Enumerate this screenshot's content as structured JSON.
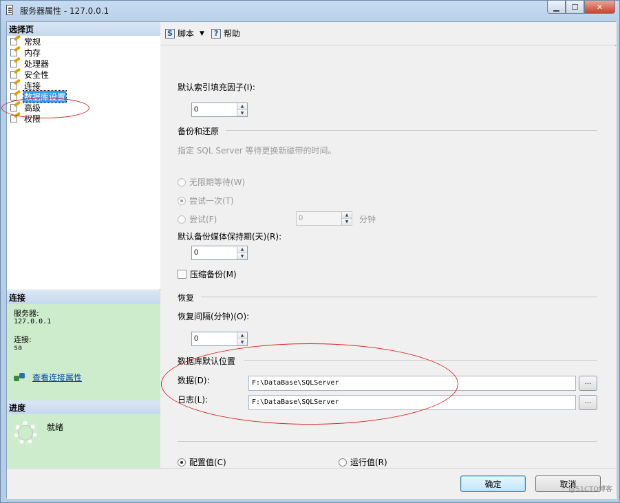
{
  "window": {
    "title": "服务器属性 - 127.0.0.1",
    "buttons": {
      "minimize": "▁",
      "maximize": "☐",
      "close": "✕"
    }
  },
  "sidebar": {
    "header": "选择页",
    "items": [
      {
        "label": "常规"
      },
      {
        "label": "内存"
      },
      {
        "label": "处理器"
      },
      {
        "label": "安全性"
      },
      {
        "label": "连接"
      },
      {
        "label": "数据库设置",
        "selected": true
      },
      {
        "label": "高级"
      },
      {
        "label": "权限"
      }
    ]
  },
  "connection": {
    "header": "连接",
    "server_label": "服务器:",
    "server_value": "127.0.0.1",
    "conn_label": "连接:",
    "conn_value": "sa",
    "link": "查看连接属性"
  },
  "progress": {
    "header": "进度",
    "status": "就绪"
  },
  "toolbar": {
    "script_label": "脚本",
    "help_label": "帮助"
  },
  "form": {
    "fill_factor_label": "默认索引填充因子(I):",
    "fill_factor_value": "0",
    "backup_group": "备份和还原",
    "backup_hint": "指定 SQL Server 等待更换新磁带的时间。",
    "radio_infinite": "无限期等待(W)",
    "radio_once": "尝试一次(T)",
    "radio_try": "尝试(F)",
    "try_minutes_value": "0",
    "minutes_unit": "分钟",
    "retention_label": "默认备份媒体保持期(天)(R):",
    "retention_value": "0",
    "compress_label": "压缩备份(M)",
    "recovery_group": "恢复",
    "recovery_interval_label": "恢复间隔(分钟)(O):",
    "recovery_interval_value": "0",
    "db_location_group": "数据库默认位置",
    "data_label": "数据(D):",
    "data_path": "F:\\DataBase\\SQLServer",
    "log_label": "日志(L):",
    "log_path": "F:\\DataBase\\SQLServer",
    "browse": "...",
    "config_value_label": "配置值(C)",
    "running_value_label": "运行值(R)"
  },
  "dialog": {
    "ok": "确定",
    "cancel": "取消"
  },
  "watermark": "@51CTO博客",
  "colors": {
    "selection": "#3399ff",
    "annotation": "#dd2222",
    "conn_bg": "#cdeccc"
  }
}
